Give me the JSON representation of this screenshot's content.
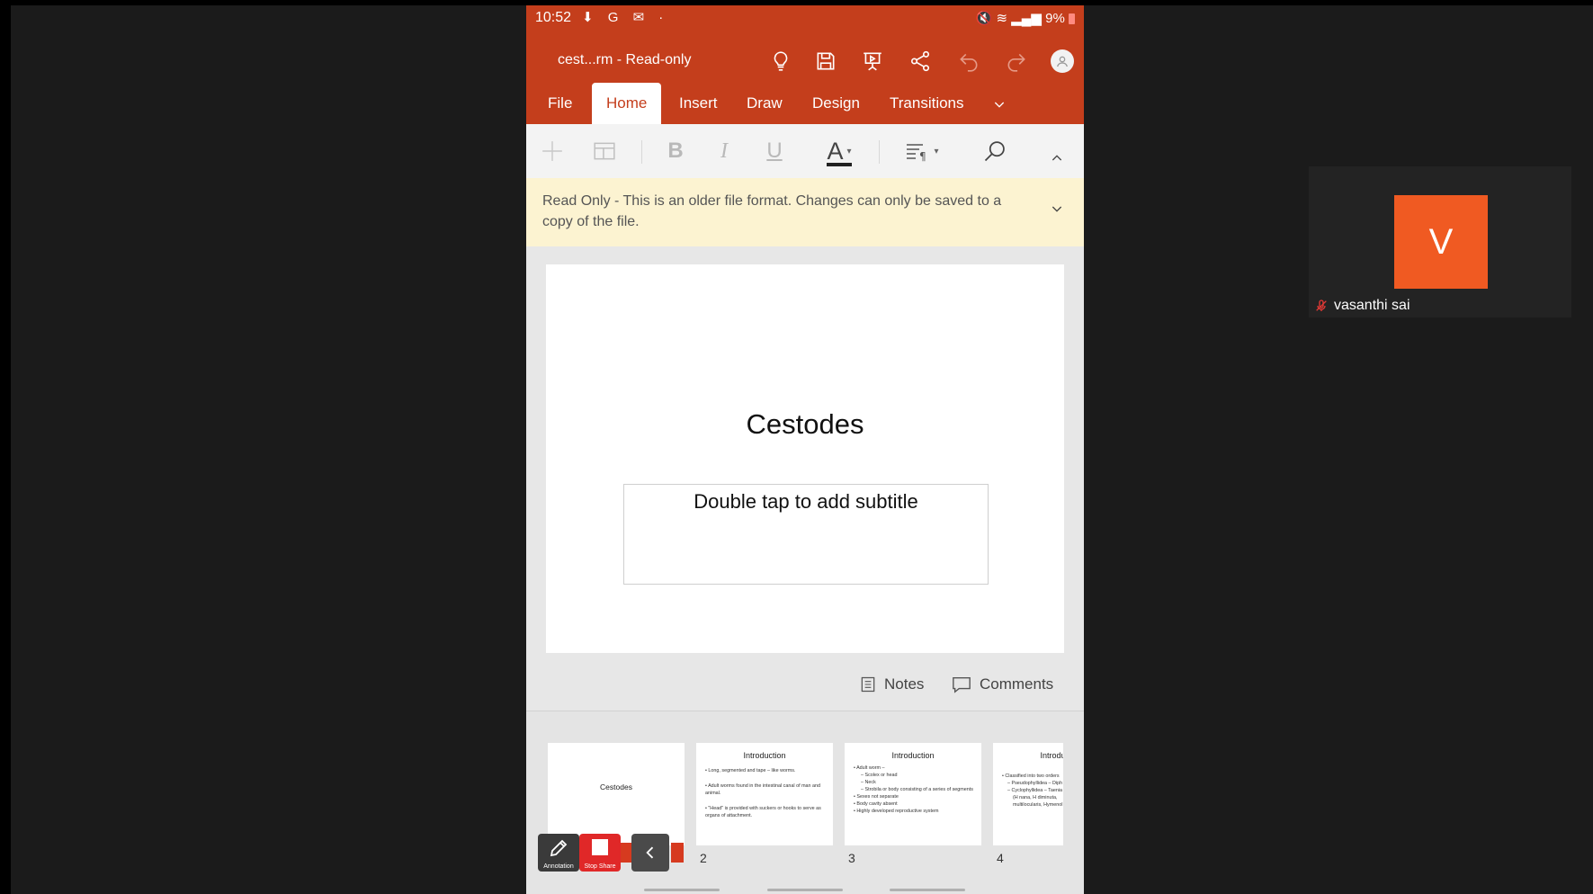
{
  "status_bar": {
    "time": "10:52",
    "icons": "⬇ G ✉ ·",
    "battery": "9%"
  },
  "app": {
    "doc_title": "cest...rm - Read-only",
    "tabs": [
      "File",
      "Home",
      "Insert",
      "Draw",
      "Design",
      "Transitions"
    ],
    "active_tab": "Home",
    "accent_color": "#c43e1c"
  },
  "toolbar": {
    "bold": "B",
    "italic": "I",
    "underline": "U",
    "font_color": "A"
  },
  "banner": {
    "text": "Read Only - This is an older file format. Changes can only be saved to a copy of the file."
  },
  "slide": {
    "title": "Cestodes",
    "subtitle_placeholder": "Double tap to add subtitle"
  },
  "notes_label": "Notes",
  "comments_label": "Comments",
  "thumbnails": [
    {
      "title": "Cestodes",
      "bullets": []
    },
    {
      "number": "2",
      "title": "Introduction",
      "bullets": [
        "• Long, segmented and tape – like worms.",
        "• Adult worms found in the intestinal canal of man and animal.",
        "• \"Head\" is provided with suckers or hooks to serve as organs of attachment."
      ]
    },
    {
      "number": "3",
      "title": "Introduction",
      "bullets": [
        "• Adult worm –",
        "– Scolex or head",
        "– Neck",
        "– Strobila or body consisting of a series of segments",
        "• Sexes not separate",
        "• Body cavity absent",
        "• Highly developed reproductive system"
      ]
    },
    {
      "number": "4",
      "title": "Introduction",
      "bullets": [
        "• Classified into two orders",
        "– Pseudophyllidea – Diph",
        "– Cyclophyllidea – Taenia",
        "(H nana, H diminuta,",
        "multilocularis, Hymenol"
      ]
    }
  ],
  "share_controls": {
    "annotation": "Annotation",
    "stop_share": "Stop Share"
  },
  "participant": {
    "initial": "V",
    "name": "vasanthi sai",
    "tile_color": "#f05a22"
  }
}
